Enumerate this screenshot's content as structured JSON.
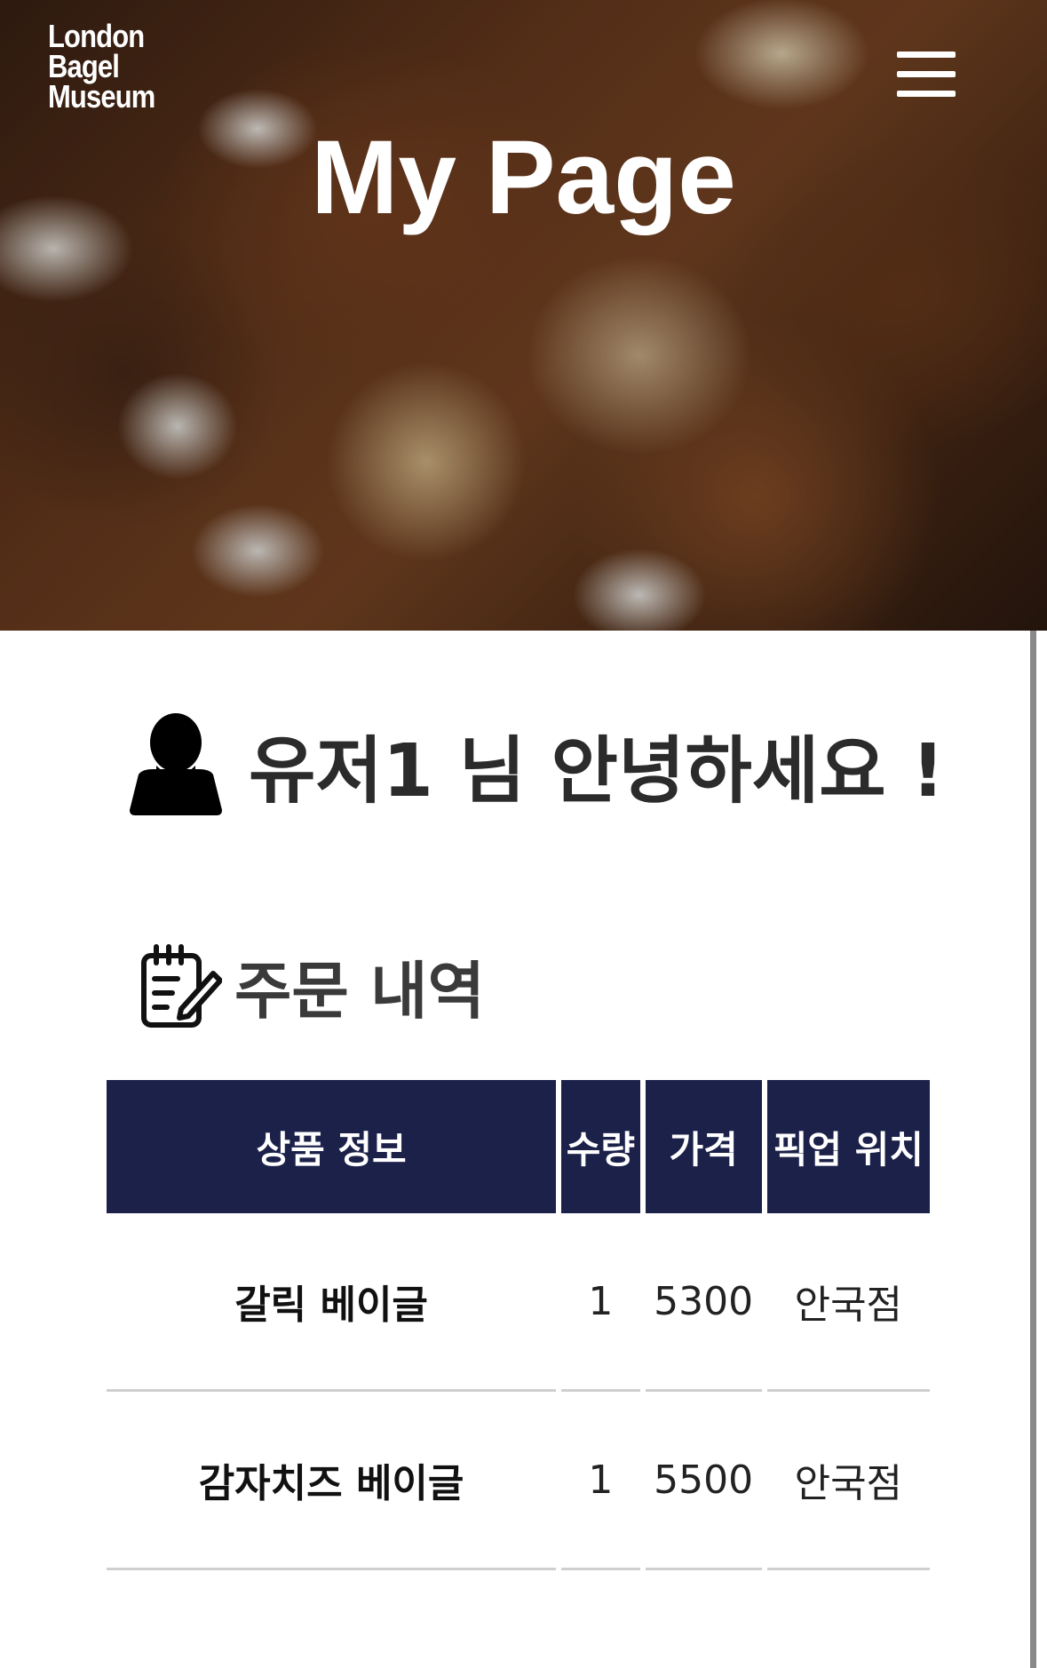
{
  "header": {
    "logo_lines": [
      "London",
      "Bagel",
      "Museum"
    ],
    "menu_icon": "hamburger-menu-icon",
    "title": "My Page"
  },
  "greeting": {
    "icon": "user-silhouette-icon",
    "text": "유저1 님 안녕하세요 !"
  },
  "orders_section": {
    "icon": "notepad-edit-icon",
    "title": "주문 내역",
    "columns": [
      "상품 정보",
      "수량",
      "가격",
      "픽업 위치"
    ],
    "rows": [
      {
        "product": "갈릭 베이글",
        "quantity": "1",
        "price": "5300",
        "location": "안국점"
      },
      {
        "product": "감자치즈 베이글",
        "quantity": "1",
        "price": "5500",
        "location": "안국점"
      }
    ]
  },
  "colors": {
    "table_header": "#1b2149",
    "text_dark": "#2b2b2b",
    "row_divider": "#cfcfcf"
  }
}
